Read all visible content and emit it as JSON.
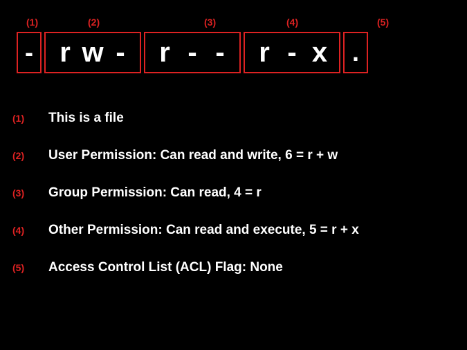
{
  "segments": [
    {
      "label": "(1)",
      "chars": [
        "-"
      ],
      "labelLeft": 38
    },
    {
      "label": "(2)",
      "chars": [
        "r",
        "w",
        "-"
      ],
      "labelLeft": 127
    },
    {
      "label": "(3)",
      "chars": [
        "r",
        "-",
        "-"
      ],
      "labelLeft": 295
    },
    {
      "label": "(4)",
      "chars": [
        "r",
        "-",
        "x"
      ],
      "labelLeft": 414
    },
    {
      "label": "(5)",
      "chars": [
        "."
      ],
      "labelLeft": 545
    }
  ],
  "explanations": [
    {
      "num": "(1)",
      "text": "This is a file"
    },
    {
      "num": "(2)",
      "text": "User Permission: Can read and write, 6 = r + w"
    },
    {
      "num": "(3)",
      "text": "Group Permission: Can read, 4 = r"
    },
    {
      "num": "(4)",
      "text": "Other Permission: Can read and execute, 5 = r + x"
    },
    {
      "num": "(5)",
      "text": "Access Control List (ACL) Flag: None"
    }
  ]
}
